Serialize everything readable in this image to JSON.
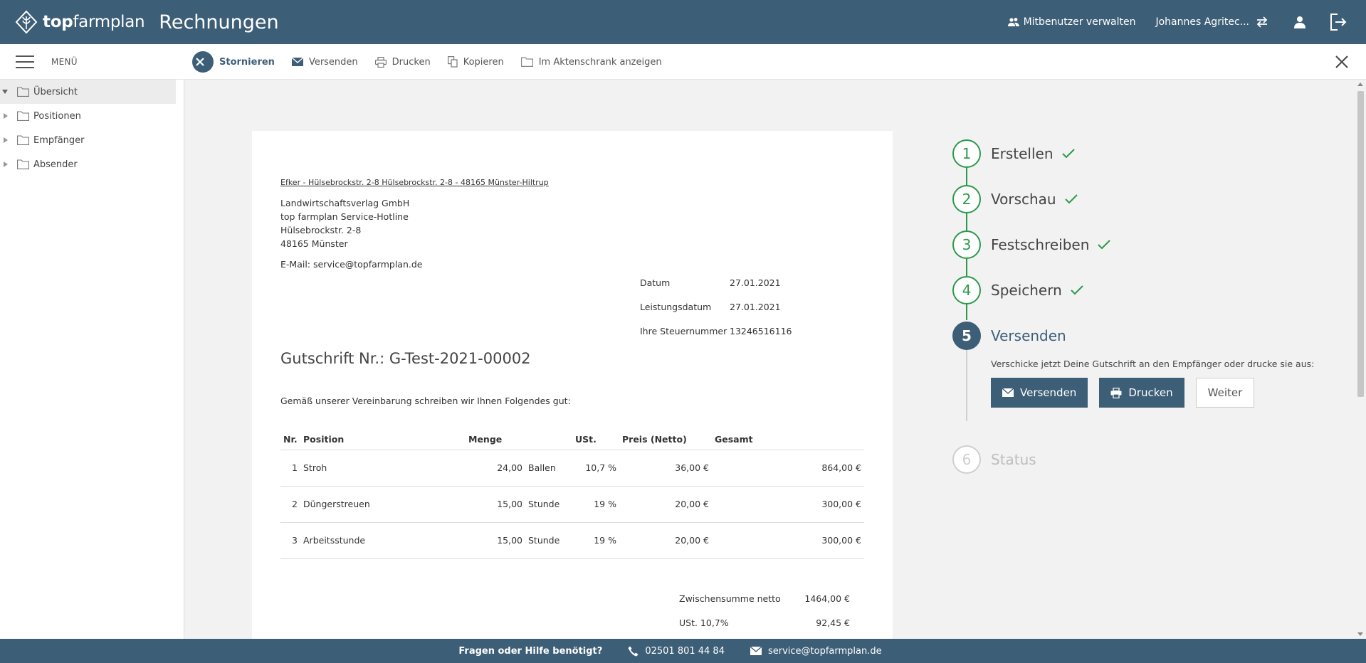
{
  "app": {
    "brand_bold": "top",
    "brand_rest": "farmplan",
    "title": "Rechnungen"
  },
  "topbar": {
    "co_users_label": "Mitbenutzer verwalten",
    "user_name": "Johannes Agritec..."
  },
  "menubar": {
    "menu_label": "MENÜ",
    "tools": {
      "cancel": "Stornieren",
      "send": "Versenden",
      "print": "Drucken",
      "copy": "Kopieren",
      "cabinet": "Im Aktenschrank anzeigen"
    }
  },
  "sidebar": {
    "items": [
      {
        "label": "Übersicht"
      },
      {
        "label": "Positionen"
      },
      {
        "label": "Empfänger"
      },
      {
        "label": "Absender"
      }
    ]
  },
  "document": {
    "sender_line": "Efker - Hülsebrockstr. 2-8 Hülsebrockstr. 2-8 - 48165 Münster-Hiltrup",
    "address": [
      "Landwirtschaftsverlag GmbH",
      "top farmplan Service-Hotline",
      "Hülsebrockstr. 2-8",
      "48165 Münster"
    ],
    "email_line": "E-Mail: service@topfarmplan.de",
    "meta": [
      {
        "key": "Datum",
        "value": "27.01.2021"
      },
      {
        "key": "Leistungsdatum",
        "value": "27.01.2021"
      },
      {
        "key": "Ihre Steuernummer",
        "value": "13246516116"
      }
    ],
    "title": "Gutschrift Nr.: G-Test-2021-00002",
    "intro": "Gemäß unserer Vereinbarung schreiben wir Ihnen Folgendes gut:",
    "columns": {
      "nr": "Nr.",
      "position": "Position",
      "menge": "Menge",
      "ust": "USt.",
      "preis": "Preis (Netto)",
      "gesamt": "Gesamt"
    },
    "rows": [
      {
        "nr": "1",
        "position": "Stroh",
        "menge": "24,00",
        "unit": "Ballen",
        "ust": "10,7 %",
        "preis": "36,00 €",
        "gesamt": "864,00 €"
      },
      {
        "nr": "2",
        "position": "Düngerstreuen",
        "menge": "15,00",
        "unit": "Stunde",
        "ust": "19 %",
        "preis": "20,00 €",
        "gesamt": "300,00 €"
      },
      {
        "nr": "3",
        "position": "Arbeitsstunde",
        "menge": "15,00",
        "unit": "Stunde",
        "ust": "19 %",
        "preis": "20,00 €",
        "gesamt": "300,00 €"
      }
    ],
    "sums": [
      {
        "key": "Zwischensumme netto",
        "value": "1464,00 €"
      },
      {
        "key": "USt. 10,7%",
        "value": "92,45 €"
      }
    ]
  },
  "stepper": {
    "steps": [
      {
        "num": "1",
        "label": "Erstellen"
      },
      {
        "num": "2",
        "label": "Vorschau"
      },
      {
        "num": "3",
        "label": "Festschreiben"
      },
      {
        "num": "4",
        "label": "Speichern"
      },
      {
        "num": "5",
        "label": "Versenden"
      },
      {
        "num": "6",
        "label": "Status"
      }
    ],
    "hint": "Verschicke jetzt Deine Gutschrift an den Empfänger oder drucke sie aus:",
    "send_btn": "Versenden",
    "print_btn": "Drucken",
    "next_btn": "Weiter"
  },
  "footer": {
    "question": "Fragen oder Hilfe benötigt?",
    "phone": "02501 801 44 84",
    "email": "service@topfarmplan.de"
  },
  "colors": {
    "primary": "#3d5e77",
    "success": "#2a9a4a",
    "background": "#f2f2f2"
  }
}
